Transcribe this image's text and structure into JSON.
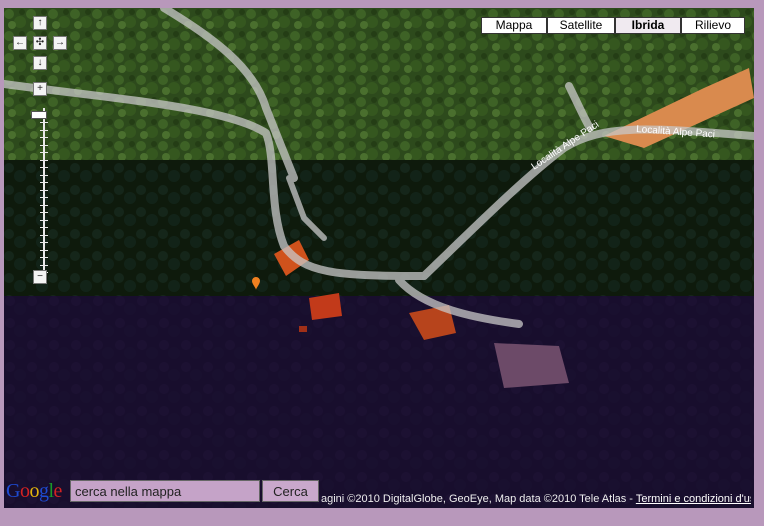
{
  "map_types": {
    "mappa": "Mappa",
    "satellite": "Satellite",
    "ibrida": "Ibrida",
    "rilievo": "Rilievo",
    "active": "ibrida"
  },
  "road_labels": {
    "label_1": "Località Alpe Paci",
    "label_2": "Località Alpe Paci"
  },
  "nav": {
    "up": "↑",
    "down": "↓",
    "left": "←",
    "right": "→",
    "center": "✣",
    "zoom_in": "+",
    "zoom_out": "−"
  },
  "search": {
    "placeholder": "cerca nella mappa",
    "value": "cerca nella mappa",
    "button_label": "Cerca"
  },
  "logo": {
    "letters": [
      "G",
      "o",
      "o",
      "g",
      "l",
      "e"
    ],
    "colors": [
      "#1e4bd2",
      "#d42222",
      "#e3b40c",
      "#1e4bd2",
      "#1a9a2a",
      "#d42222"
    ]
  },
  "attribution": {
    "text": "agini ©2010 DigitalGlobe, GeoEye, Map data ©2010 Tele Atlas - ",
    "terms_link": "Termini e condizioni d'uso"
  },
  "colors": {
    "frame": "#b898bb",
    "road": "#c8c8c8"
  }
}
